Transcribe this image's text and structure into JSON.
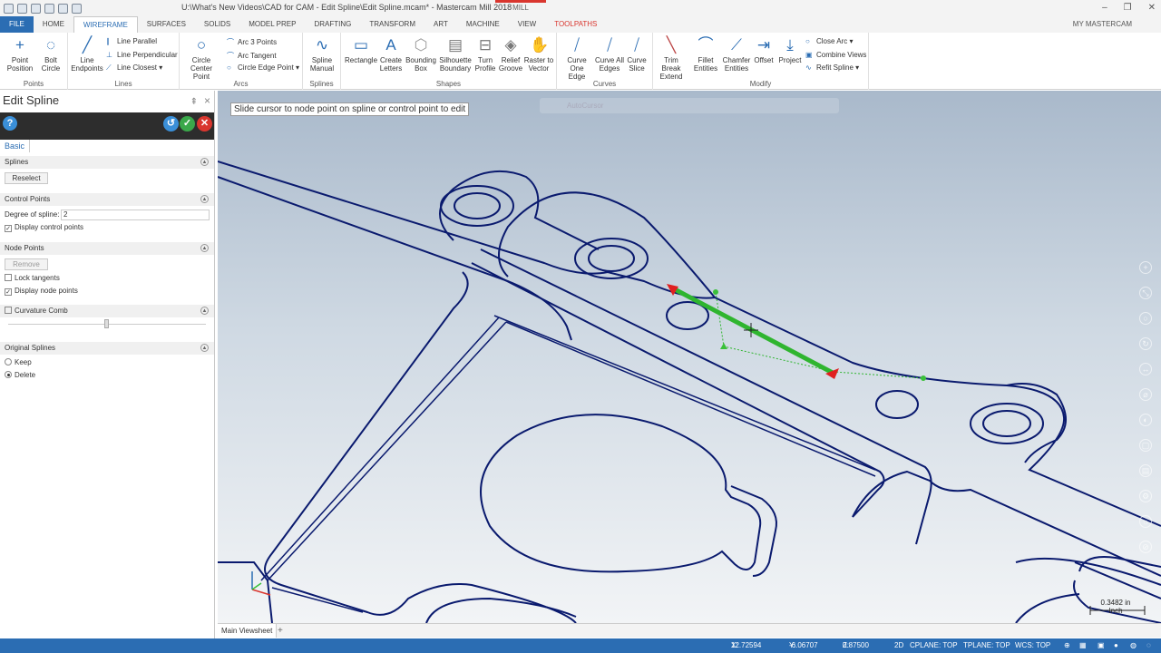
{
  "window": {
    "title": "U:\\What's New Videos\\CAD for CAM - Edit Spline\\Edit Spline.mcam* - Mastercam Mill 2018",
    "context_label": "MILL",
    "my_mastercam": "MY MASTERCAM"
  },
  "tabs": [
    "FILE",
    "HOME",
    "WIREFRAME",
    "SURFACES",
    "SOLIDS",
    "MODEL PREP",
    "DRAFTING",
    "TRANSFORM",
    "ART",
    "MACHINE",
    "VIEW",
    "TOOLPATHS"
  ],
  "ribbon": {
    "points": {
      "label": "Points",
      "point_position": "Point Position",
      "bolt_circle": "Bolt Circle"
    },
    "lines": {
      "label": "Lines",
      "line_endpoints": "Line Endpoints",
      "line_parallel": "Line Parallel",
      "line_perpendicular": "Line Perpendicular",
      "line_closest": "Line Closest"
    },
    "arcs": {
      "label": "Arcs",
      "circle_center_point": "Circle Center Point",
      "arc_3_points": "Arc 3 Points",
      "arc_tangent": "Arc Tangent",
      "circle_edge_point": "Circle Edge Point"
    },
    "splines": {
      "label": "Splines",
      "spline_manual": "Spline Manual"
    },
    "shapes": {
      "label": "Shapes",
      "rectangle": "Rectangle",
      "create_letters": "Create Letters",
      "bounding_box": "Bounding Box",
      "silhouette_boundary": "Silhouette Boundary",
      "turn_profile": "Turn Profile",
      "relief_groove": "Relief Groove",
      "raster_to_vector": "Raster to Vector"
    },
    "curves": {
      "label": "Curves",
      "curve_one_edge": "Curve One Edge",
      "curve_all_edges": "Curve All Edges",
      "curve_slice": "Curve Slice"
    },
    "modify": {
      "label": "Modify",
      "trim_break_extend": "Trim Break Extend",
      "fillet_entities": "Fillet Entities",
      "chamfer_entities": "Chamfer Entities",
      "offset": "Offset",
      "project": "Project",
      "close_arc": "Close Arc",
      "combine_views": "Combine Views",
      "refit_spline": "Refit Spline"
    }
  },
  "panel": {
    "title": "Edit Spline",
    "tab": "Basic",
    "splines": {
      "header": "Splines",
      "reselect": "Reselect"
    },
    "control_points": {
      "header": "Control Points",
      "degree_label": "Degree of spline:",
      "degree_value": "2",
      "display_control_points": "Display control points"
    },
    "node_points": {
      "header": "Node Points",
      "remove": "Remove",
      "lock_tangents": "Lock tangents",
      "display_node_points": "Display node points"
    },
    "curvature_comb": {
      "header": "Curvature Comb"
    },
    "original_splines": {
      "header": "Original Splines",
      "keep": "Keep",
      "delete": "Delete"
    }
  },
  "viewport": {
    "tooltip": "Slide cursor to node point on spline or control point to edit",
    "autocursor": "AutoCursor",
    "scale_value": "0.3482 in",
    "scale_unit": "Inch",
    "colors": {
      "geometry": "#0a1a6e",
      "spline_edit": "#2fb52f",
      "arrow": "#e02020"
    }
  },
  "view_tabs": {
    "main": "Main Viewsheet",
    "add": "+"
  },
  "status": {
    "x_label": "X:",
    "x_value": "12.72594",
    "y_label": "Y:",
    "y_value": "-6.06707",
    "z_label": "Z:",
    "z_value": "0.87500",
    "mode": "2D",
    "cplane": "CPLANE: TOP",
    "tplane": "TPLANE: TOP",
    "wcs": "WCS: TOP"
  }
}
